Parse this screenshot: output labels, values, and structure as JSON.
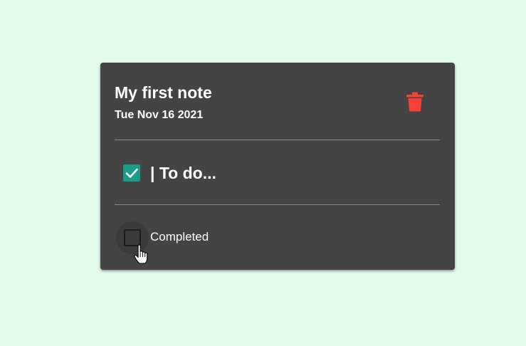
{
  "note": {
    "title": "My first note",
    "date": "Tue Nov 16 2021",
    "delete_icon": "trash-icon",
    "todo": {
      "text": "| To do...",
      "checked": true
    },
    "completed": {
      "label": "Completed",
      "checked": false
    }
  },
  "colors": {
    "background": "#e2fbea",
    "card": "#444444",
    "accent": "#1a9c88",
    "danger": "#f44336"
  }
}
